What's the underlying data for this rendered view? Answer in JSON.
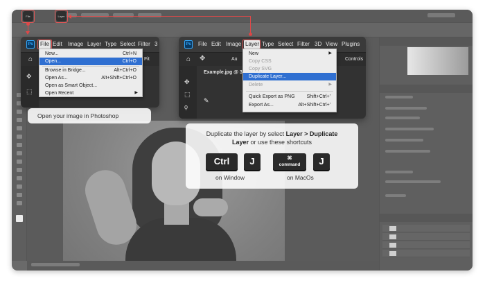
{
  "background_photoshop": {
    "mini_file_label": "File",
    "mini_layer_label": "Layer"
  },
  "file_panel": {
    "logo": "Ps",
    "menubar": [
      "File",
      "Edit",
      "Image",
      "Layer",
      "Type",
      "Select",
      "Filter",
      "3"
    ],
    "active_menu": "File",
    "dropdown": [
      {
        "label": "New...",
        "shortcut": "Ctrl+N",
        "highlighted": false
      },
      {
        "label": "Open...",
        "shortcut": "Ctrl+O",
        "highlighted": true
      },
      {
        "label": "Browse in Bridge...",
        "shortcut": "Alt+Ctrl+O",
        "highlighted": false
      },
      {
        "label": "Open As...",
        "shortcut": "Alt+Shift+Ctrl+O",
        "highlighted": false
      },
      {
        "label": "Open as Smart Object...",
        "shortcut": "",
        "highlighted": false
      },
      {
        "label": "Open Recent",
        "shortcut": "",
        "highlighted": false,
        "submenu": true
      }
    ],
    "option_fit_label": "Fit"
  },
  "layer_panel": {
    "logo": "Ps",
    "menubar": [
      "File",
      "Edit",
      "Image",
      "Layer",
      "Type",
      "Select",
      "Filter",
      "3D",
      "View",
      "Plugins"
    ],
    "active_menu": "Layer",
    "tab_title": "Example.jpg @ 3",
    "option_auto_label": "Au",
    "option_controls_label": "Controls",
    "dropdown": [
      {
        "label": "New",
        "shortcut": "",
        "disabled": false,
        "submenu": true
      },
      {
        "label": "Copy CSS",
        "shortcut": "",
        "disabled": true
      },
      {
        "label": "Copy SVG",
        "shortcut": "",
        "disabled": true
      },
      {
        "label": "Duplicate Layer...",
        "shortcut": "",
        "highlighted": true
      },
      {
        "label": "Delete",
        "shortcut": "",
        "disabled": true,
        "submenu": true
      },
      {
        "label": "Quick Export as PNG",
        "shortcut": "Shift+Ctrl+'"
      },
      {
        "label": "Export As...",
        "shortcut": "Alt+Shift+Ctrl+'"
      }
    ]
  },
  "captions": {
    "open_image": "Open your image in Photoshop",
    "instruction_pre": "Duplicate the layer by select ",
    "instruction_bold1": "Layer > Duplicate",
    "instruction_bold2": "Layer",
    "instruction_post": " or use these shortcuts"
  },
  "shortcuts": {
    "windows": {
      "keys": [
        "Ctrl",
        "J"
      ],
      "label": "on Window"
    },
    "mac": {
      "keys": [
        "command",
        "J"
      ],
      "command_glyph": "⌘",
      "label": "on MacOs"
    }
  },
  "colors": {
    "accent_red": "#e24848",
    "menu_highlight": "#2f6fd1",
    "ps_blue": "#31a8ff"
  },
  "icons": [
    "home-icon",
    "move-tool-icon",
    "marquee-tool-icon",
    "lasso-tool-icon",
    "brush-tool-icon",
    "command-icon",
    "submenu-arrow-icon"
  ]
}
